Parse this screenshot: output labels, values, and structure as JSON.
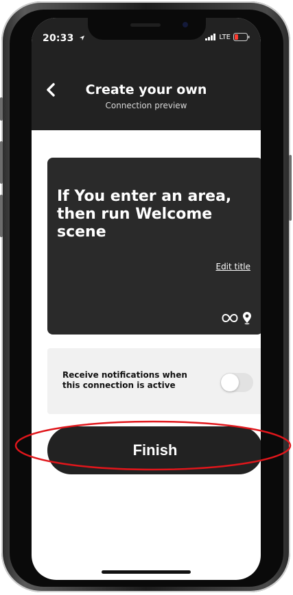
{
  "status_bar": {
    "time": "20:33",
    "network": "LTE"
  },
  "header": {
    "title": "Create your own",
    "subtitle": "Connection preview"
  },
  "card": {
    "title": "If You enter an area, then run Welcome scene",
    "edit_link": "Edit title",
    "icons": [
      "infinity-link-icon",
      "location-pin-icon"
    ]
  },
  "notification": {
    "label": "Receive notifications when this connection is active",
    "enabled": false
  },
  "finish_button": {
    "label": "Finish"
  },
  "annotation": {
    "type": "ellipse",
    "color": "#e0161b",
    "target": "finish-button"
  }
}
